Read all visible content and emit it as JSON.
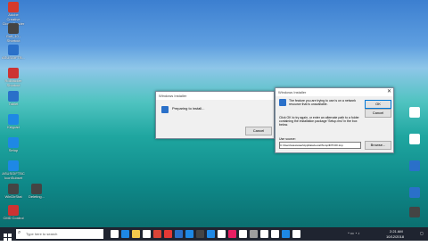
{
  "desktop_icons": [
    {
      "label": "Adobe Creative Cloud Reader",
      "color": "#d43a2c"
    },
    {
      "label": "Golf_10 - Shortcut",
      "color": "#555"
    },
    {
      "label": "ASUSGIFTB...",
      "color": "#2a70c9"
    },
    {
      "label": "Rollbacker Shortcut",
      "color": "#cc3333"
    },
    {
      "label": "Tablet",
      "color": "#2a70c9"
    },
    {
      "label": "Keypad",
      "color": "#1e88e5"
    },
    {
      "label": "Setup",
      "color": "#1e88e5"
    },
    {
      "label": "ASUSGIFTBC IconSubset",
      "color": "#1e88e5"
    },
    {
      "label": "WinDirStat",
      "color": "#444"
    },
    {
      "label": "CMD Control",
      "color": "#cc3333"
    },
    {
      "label": "Deleting...",
      "color": "#444"
    }
  ],
  "installer_progress": {
    "title": "Windows Installer",
    "message": "Preparing to install...",
    "cancel": "Cancel"
  },
  "installer_error": {
    "title": "Windows Installer",
    "message": "The feature you are trying to use is on a network resource that is unavailable.",
    "instructions": "Click OK to try again, or enter an alternate path to a folder containing the installation package 'Setup.msi' in the box below.",
    "use_source_label": "Use source:",
    "source_value": "C:\\Users\\Hewscaw\\AppData\\Local\\Temp\\lDTCFF.tmp",
    "ok": "OK",
    "cancel": "Cancel",
    "browse": "Browse..."
  },
  "taskbar": {
    "search_placeholder": "Type here to search",
    "time": "2:21 AM",
    "date": "10/12/2018"
  },
  "colors": {
    "taskbar": "#1f2430",
    "accent": "#0078d7"
  }
}
